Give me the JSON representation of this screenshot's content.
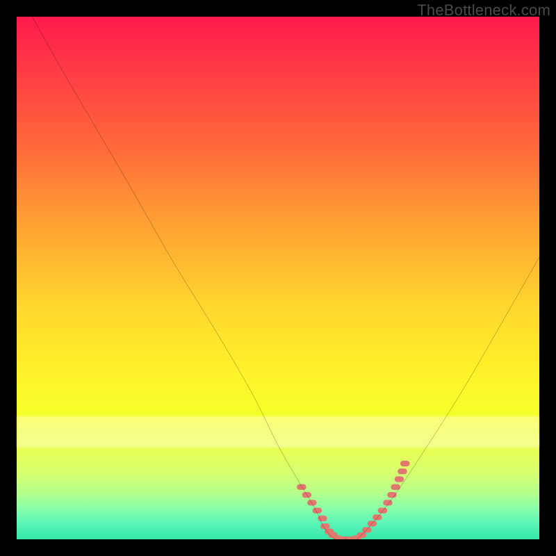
{
  "watermark": "TheBottleneck.com",
  "colors": {
    "page_bg": "#000000",
    "curve": "#000000",
    "marker": "#e07870",
    "gradient_top": "#ff1a4c",
    "gradient_bottom": "#33e8a8"
  },
  "chart_data": {
    "type": "line",
    "title": "",
    "xlabel": "",
    "ylabel": "",
    "xlim": [
      0,
      100
    ],
    "ylim": [
      0,
      100
    ],
    "grid": false,
    "legend": false,
    "series": [
      {
        "name": "bottleneck-curve",
        "x": [
          3,
          8,
          15,
          22,
          30,
          38,
          45,
          50,
          54,
          57,
          59,
          61,
          63,
          65,
          68,
          72,
          78,
          85,
          92,
          100
        ],
        "y": [
          100,
          91,
          79,
          67,
          53,
          40,
          28,
          18,
          11,
          6,
          2,
          0,
          0,
          0,
          3,
          8,
          17,
          28,
          40,
          54
        ]
      }
    ],
    "markers": {
      "name": "highlight-dots",
      "x": [
        54.5,
        55.5,
        56.5,
        57.5,
        58.5,
        59,
        59.8,
        60.5,
        61.5,
        62,
        63,
        64,
        65,
        66,
        67,
        68,
        69,
        70,
        71,
        71.8,
        72.5,
        73.2,
        73.8,
        74.3
      ],
      "y": [
        10,
        8.5,
        7,
        5.5,
        4,
        2.5,
        1.5,
        0.8,
        0.2,
        0,
        0,
        0,
        0.2,
        0.8,
        1.8,
        3,
        4.2,
        5.5,
        7,
        8.5,
        10,
        11.5,
        13,
        14.5
      ]
    }
  }
}
